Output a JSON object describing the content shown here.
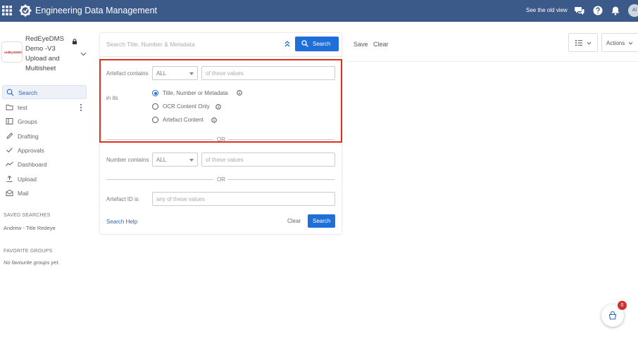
{
  "header": {
    "app_title": "Engineering Data Management",
    "old_view_link": "See the old view",
    "avatar_initials": "Al",
    "bar_color": "#3b5a8a"
  },
  "project": {
    "name": "RedEyeDMS Demo -V3 Upload and Multisheet",
    "thumb_text": "redEyeDMS"
  },
  "sidebar": {
    "items": [
      {
        "label": "Search",
        "icon": "search-icon",
        "active": true
      },
      {
        "label": "test",
        "icon": "folder-icon"
      },
      {
        "label": "Groups",
        "icon": "groups-icon"
      },
      {
        "label": "Drafting",
        "icon": "pencil-icon"
      },
      {
        "label": "Approvals",
        "icon": "check-icon"
      },
      {
        "label": "Dashboard",
        "icon": "chart-line-icon"
      },
      {
        "label": "Upload",
        "icon": "upload-icon"
      },
      {
        "label": "Mail",
        "icon": "mail-icon"
      }
    ],
    "saved_searches_heading": "SAVED SEARCHES",
    "saved_searches": [
      "Andrew - Title Redeye"
    ],
    "favorite_groups_heading": "FAVORITE GROUPS",
    "favorite_groups_empty": "No favourite groups yet."
  },
  "search_card": {
    "search_placeholder": "Search Title, Number & Metadata",
    "search_button": "Search",
    "artefact_contains_label": "Artefact contains",
    "artefact_select_value": "ALL",
    "artefact_values_placeholder": "of these values",
    "in_its_label": "in its",
    "radio_options": [
      {
        "label": "Title, Number or Metadata",
        "checked": true
      },
      {
        "label": "OCR Content Only",
        "checked": false
      },
      {
        "label": "Artefact Content",
        "checked": false
      }
    ],
    "or_text": "OR",
    "number_contains_label": "Number contains",
    "number_select_value": "ALL",
    "number_values_placeholder": "of these values",
    "artefact_id_label": "Artefact ID is",
    "artefact_id_placeholder": "any of these values",
    "search_help_link": "Search Help",
    "clear_button": "Clear",
    "bottom_search_button": "Search"
  },
  "toolbar": {
    "save_label": "Save",
    "clear_label": "Clear",
    "actions_label": "Actions"
  },
  "cart": {
    "badge_count": "0"
  },
  "colors": {
    "accent": "#1e6fd9",
    "highlight_border": "#e0321a"
  }
}
